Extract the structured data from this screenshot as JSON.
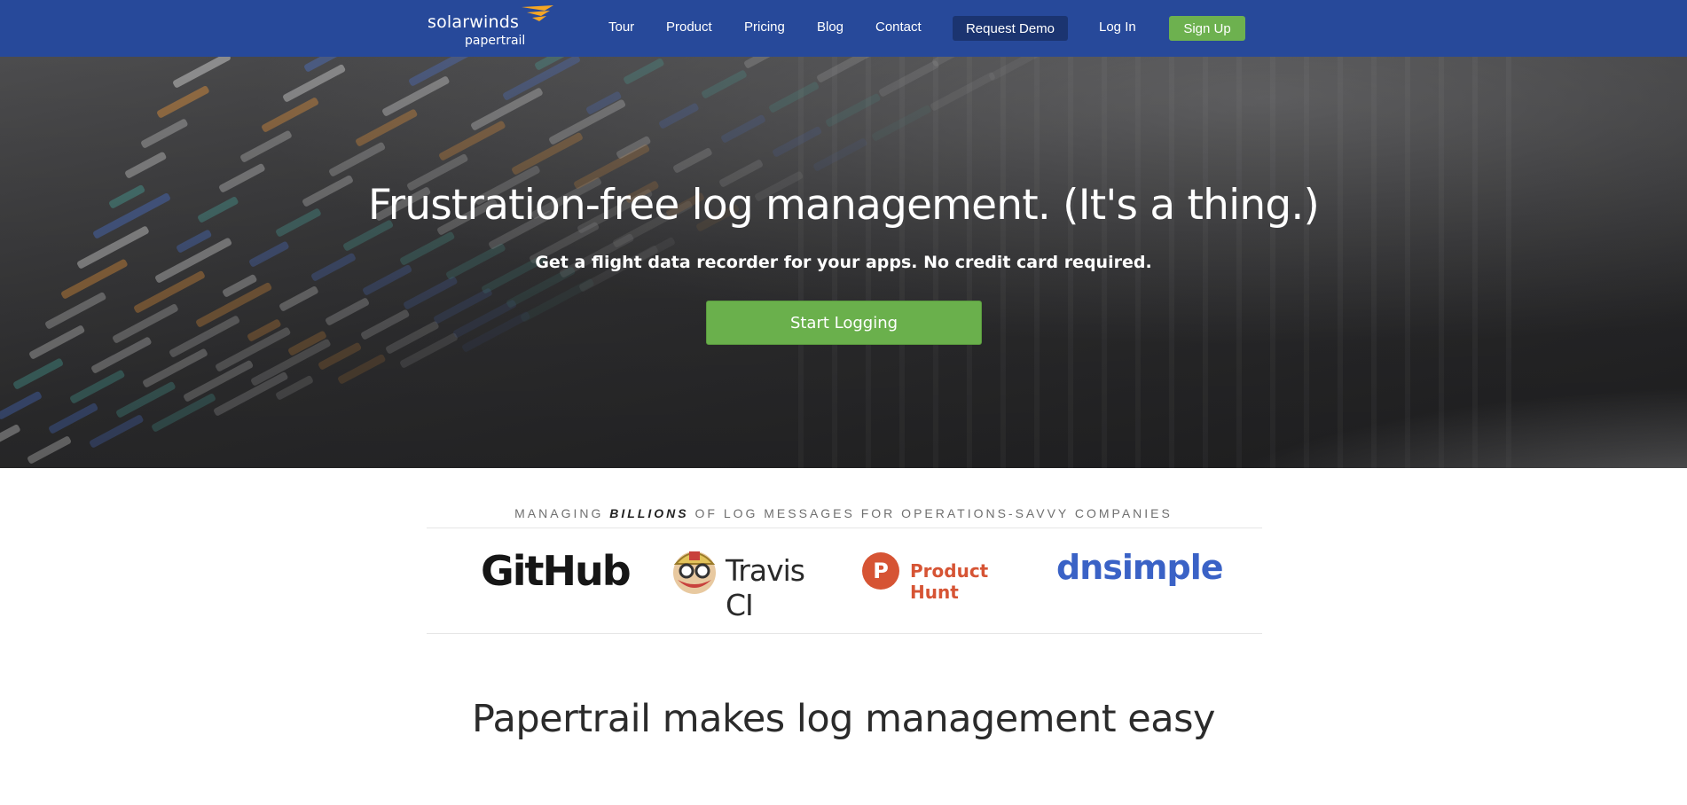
{
  "brand": {
    "logo_name": "solarwinds",
    "logo_product": "papertrail"
  },
  "nav": {
    "links": [
      "Tour",
      "Product",
      "Pricing",
      "Blog",
      "Contact"
    ],
    "request_demo": "Request Demo",
    "login": "Log In",
    "signup": "Sign Up"
  },
  "hero": {
    "title": "Frustration-free log management. (It's a thing.)",
    "subtitle": "Get a flight data recorder for your apps. No credit card required.",
    "cta": "Start Logging"
  },
  "customers": {
    "tagline_prefix": "MANAGING",
    "tagline_emphasis": "BILLIONS",
    "tagline_suffix": "OF LOG MESSAGES FOR OPERATIONS-SAVVY COMPANIES",
    "logos": [
      "GitHub",
      "Travis CI",
      "Product Hunt",
      "dnsimple"
    ]
  },
  "section": {
    "title": "Papertrail makes log management easy"
  },
  "colors": {
    "nav_bg": "#27499a",
    "demo_btn": "#1b3470",
    "green": "#6ab04c",
    "product_hunt": "#d65434",
    "dnsimple": "#3a62c6",
    "logo_accent": "#f5a623"
  }
}
